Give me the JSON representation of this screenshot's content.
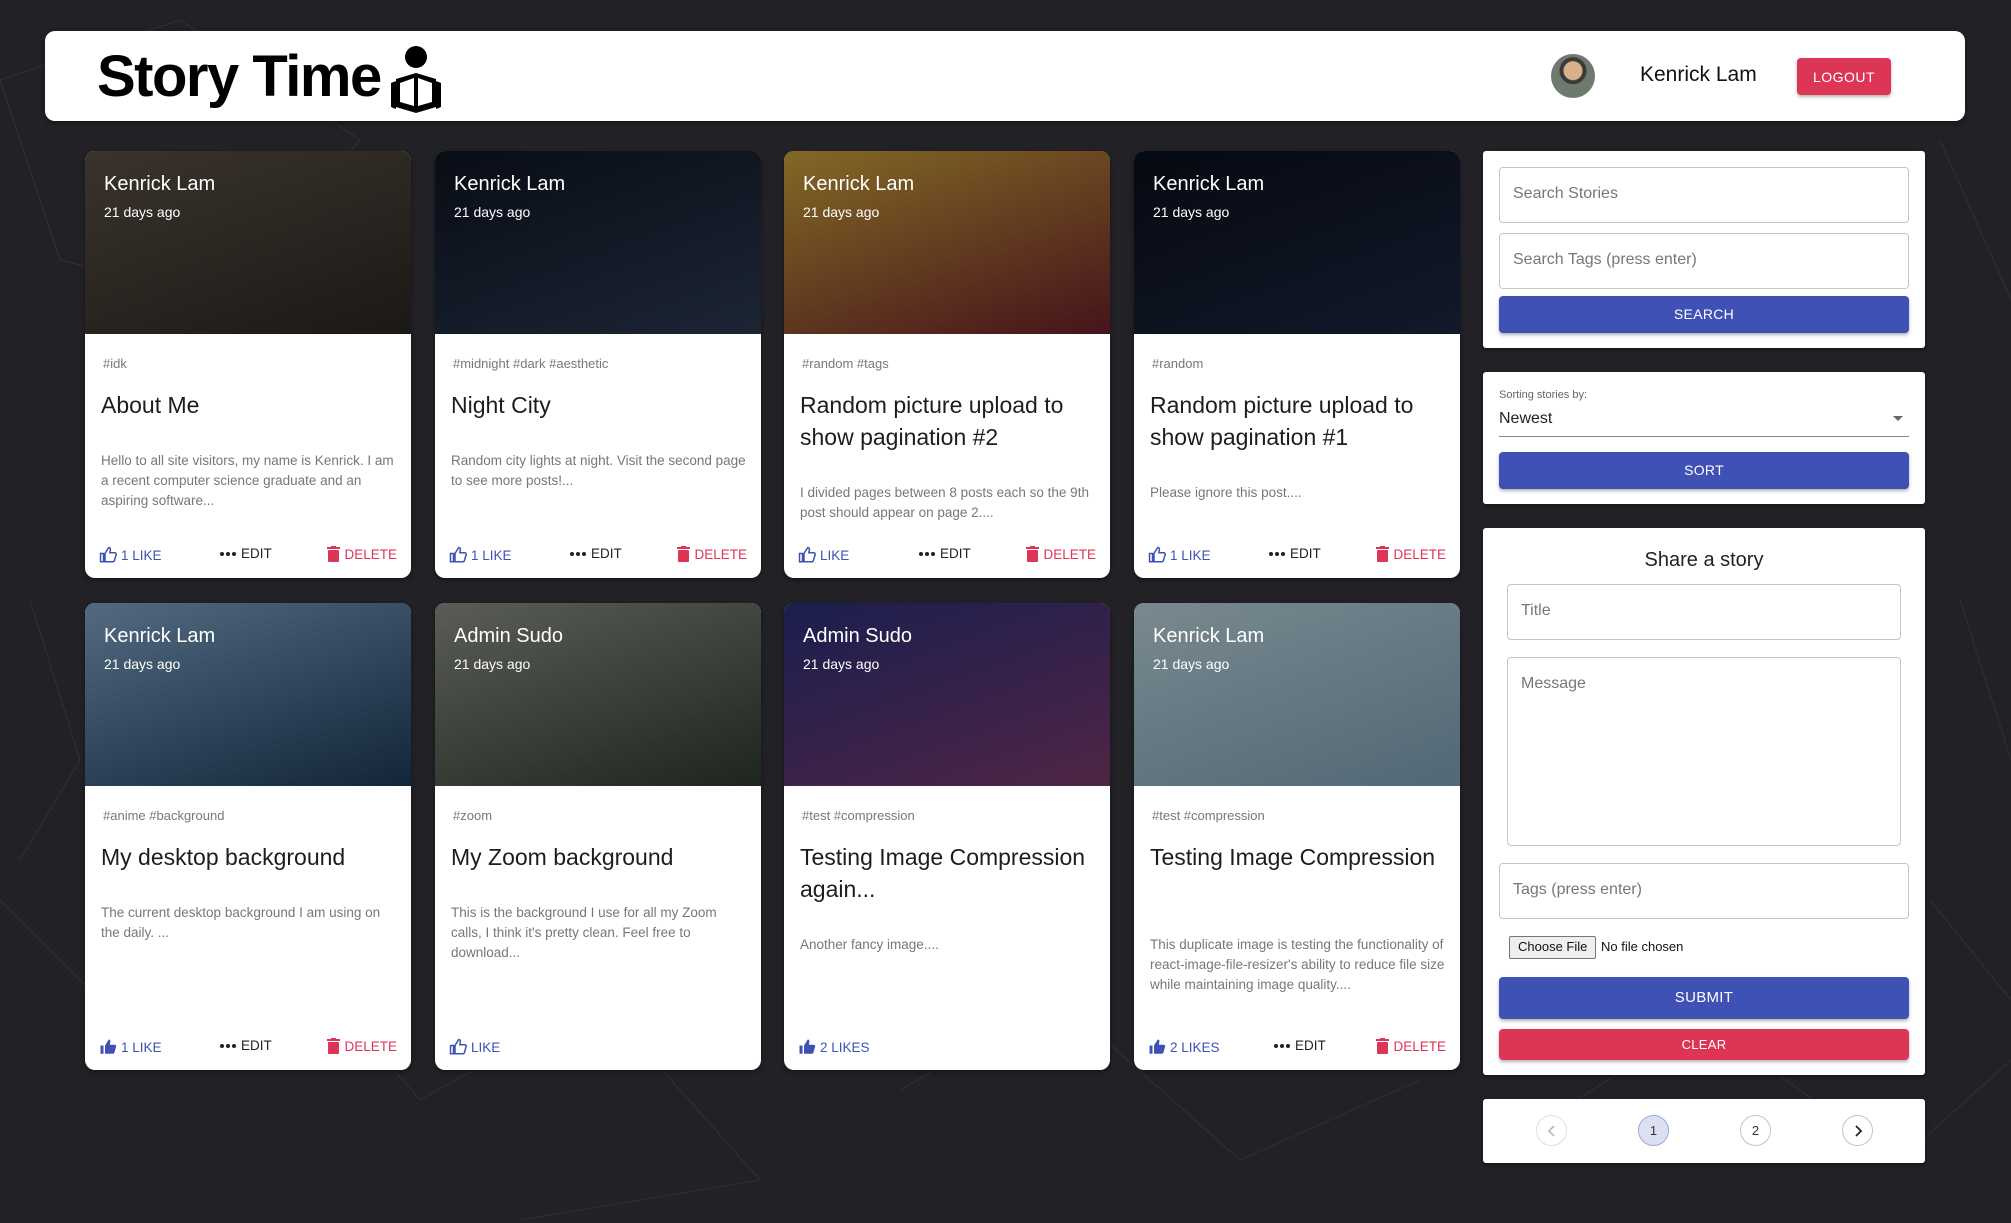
{
  "header": {
    "brand_title": "Story Time",
    "user_name": "Kenrick Lam",
    "logout_label": "LOGOUT"
  },
  "actions": {
    "edit_label": "EDIT",
    "delete_label": "DELETE"
  },
  "posts": [
    {
      "author": "Kenrick Lam",
      "time": "21 days ago",
      "tags": "#idk",
      "title": "About Me",
      "message": "Hello to all site visitors, my name is Kenrick. I am a recent computer science graduate and an aspiring software...",
      "like_label": "1 LIKE",
      "editable": true,
      "image_colors": [
        "#5a5044",
        "#2a2622"
      ]
    },
    {
      "author": "Kenrick Lam",
      "time": "21 days ago",
      "tags": "#midnight #dark #aesthetic",
      "title": "Night City",
      "message": "Random city lights at night. Visit the second page to see more posts!...",
      "like_label": "1 LIKE",
      "editable": true,
      "image_colors": [
        "#0d1422",
        "#2c3a52"
      ]
    },
    {
      "author": "Kenrick Lam",
      "time": "21 days ago",
      "tags": "#random #tags",
      "title": "Random picture upload to show pagination #2",
      "message": "I divided pages between 8 posts each so the 9th post should appear on page 2....",
      "like_label": "LIKE",
      "editable": true,
      "image_colors": [
        "#c9a13a",
        "#6d1e2a"
      ]
    },
    {
      "author": "Kenrick Lam",
      "time": "21 days ago",
      "tags": "#random",
      "title": "Random picture upload to show pagination #1",
      "message": "Please ignore this post....",
      "like_label": "1 LIKE",
      "editable": true,
      "image_colors": [
        "#0a0f1c",
        "#1c2740"
      ]
    },
    {
      "author": "Kenrick Lam",
      "time": "21 days ago",
      "tags": "#anime #background",
      "title": "My desktop background",
      "message": "The current desktop background I am using on the daily. ...",
      "like_label": "1 LIKE",
      "editable": true,
      "image_colors": [
        "#7fa3c6",
        "#1d3a58"
      ]
    },
    {
      "author": "Admin Sudo",
      "time": "21 days ago",
      "tags": "#zoom",
      "title": "My Zoom background",
      "message": "This is the background I use for all my Zoom calls, I think it's pretty clean. Feel free to download...",
      "like_label": "LIKE",
      "editable": false,
      "image_colors": [
        "#8b8e88",
        "#2f3a2c"
      ]
    },
    {
      "author": "Admin Sudo",
      "time": "21 days ago",
      "tags": "#test #compression",
      "title": "Testing Image Compression again...",
      "message": "Another fancy image....",
      "like_label": "2 LIKES",
      "editable": false,
      "image_colors": [
        "#2a2f7a",
        "#7a3a6a"
      ]
    },
    {
      "author": "Kenrick Lam",
      "time": "21 days ago",
      "tags": "#test #compression",
      "title": "Testing Image Compression",
      "message": "This duplicate image is testing the functionality of react-image-file-resizer's ability to reduce file size while maintaining image quality....",
      "like_label": "2 LIKES",
      "editable": true,
      "image_colors": [
        "#b9d2dc",
        "#7da0b4"
      ]
    }
  ],
  "search": {
    "stories_placeholder": "Search Stories",
    "tags_placeholder": "Search Tags (press enter)",
    "button_label": "SEARCH"
  },
  "sort": {
    "label": "Sorting stories by:",
    "value": "Newest",
    "button_label": "SORT"
  },
  "share": {
    "heading": "Share a story",
    "title_placeholder": "Title",
    "message_placeholder": "Message",
    "tags_placeholder": "Tags (press enter)",
    "choose_file_label": "Choose File",
    "no_file_text": "No file chosen",
    "submit_label": "SUBMIT",
    "clear_label": "CLEAR"
  },
  "pagination": {
    "pages": [
      "1",
      "2"
    ],
    "current": "1"
  },
  "colors": {
    "primary": "#3f51b5",
    "danger": "#dc3555",
    "background": "#222226"
  }
}
